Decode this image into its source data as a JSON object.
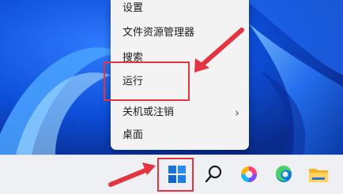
{
  "context_menu": {
    "items": [
      {
        "label": "设置",
        "has_submenu": false
      },
      {
        "label": "文件资源管理器",
        "has_submenu": false
      },
      {
        "label": "搜索",
        "has_submenu": false
      },
      {
        "label": "运行",
        "has_submenu": false
      },
      {
        "label": "关机或注销",
        "has_submenu": true,
        "submenu_glyph": "›"
      },
      {
        "label": "桌面",
        "has_submenu": false
      }
    ],
    "highlighted_item": "运行"
  },
  "taskbar": {
    "buttons": [
      {
        "name": "start",
        "icon": "windows-logo-icon",
        "highlighted": true
      },
      {
        "name": "search",
        "icon": "search-icon"
      },
      {
        "name": "copilot",
        "icon": "copilot-icon"
      },
      {
        "name": "edge",
        "icon": "edge-browser-icon"
      },
      {
        "name": "file-explorer",
        "icon": "folder-icon"
      }
    ]
  },
  "annotations": {
    "color": "#e3343f",
    "arrows": 2,
    "boxes": 2
  }
}
